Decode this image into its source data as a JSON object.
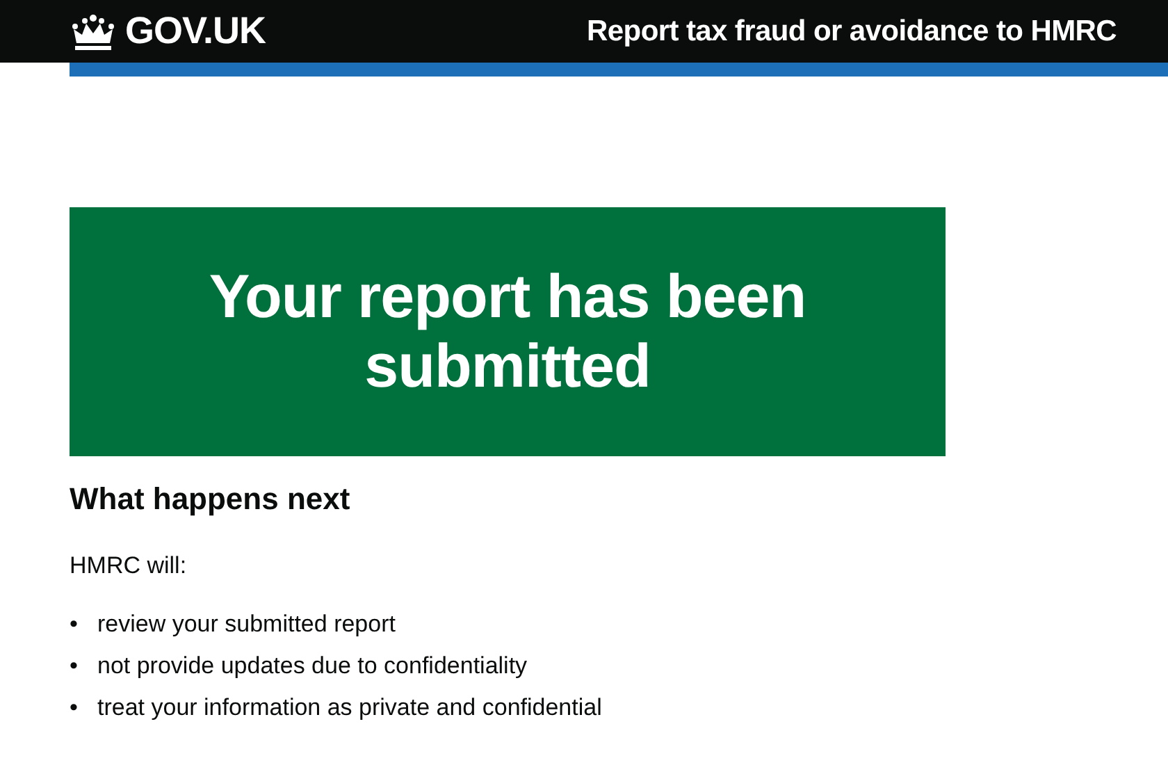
{
  "header": {
    "logo_text": "GOV.UK",
    "service_name": "Report tax fraud or avoidance to HMRC"
  },
  "panel": {
    "title": "Your report has been submitted"
  },
  "next_steps": {
    "heading": "What happens next",
    "intro": "HMRC will:",
    "items": [
      {
        "marker": "•",
        "text": "review your submitted report"
      },
      {
        "marker": "•",
        "text": "not provide updates due to confidentiality"
      },
      {
        "marker": "•",
        "text": "treat your information as private and confidential"
      }
    ]
  }
}
